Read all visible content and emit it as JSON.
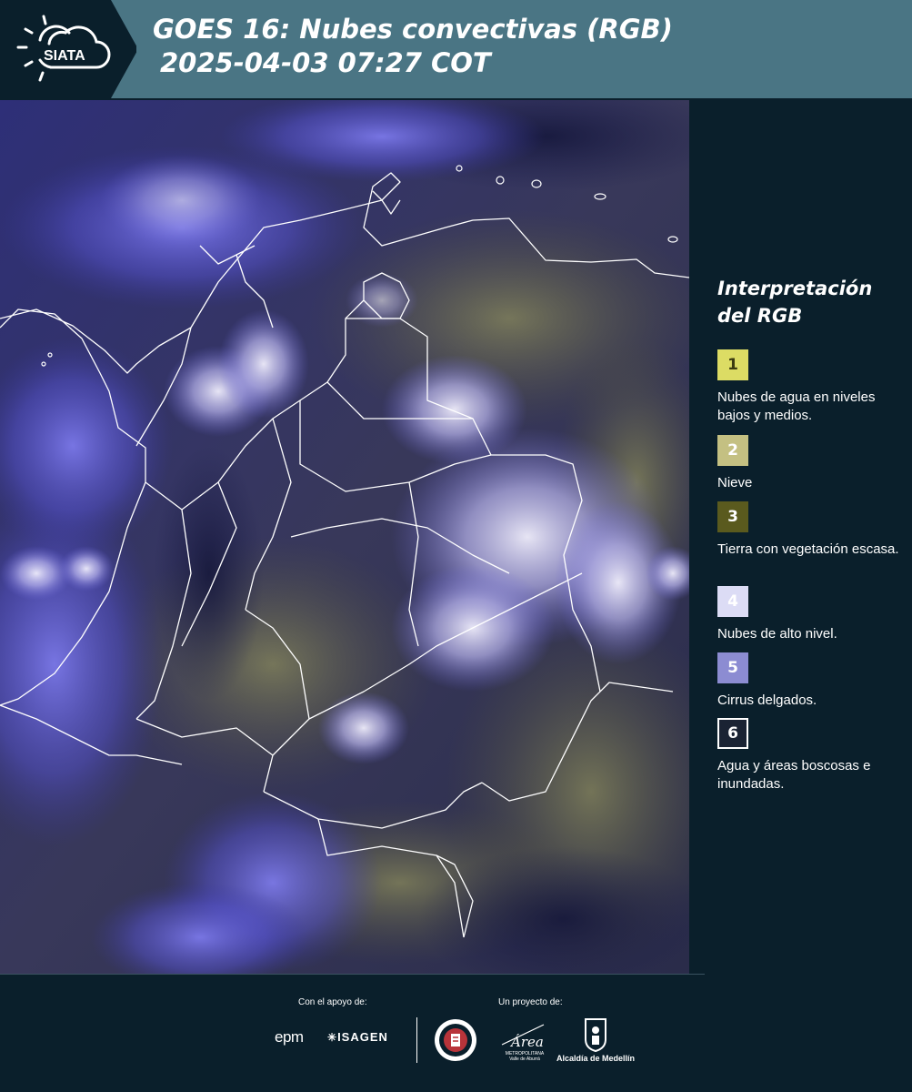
{
  "header": {
    "logo_text": "SIATA",
    "title_line1": "GOES 16: Nubes convectivas (RGB)",
    "title_line2": "2025-04-03 07:27 COT"
  },
  "legend": {
    "title": "Interpretación del RGB",
    "items": [
      {
        "number": "1",
        "label": "Nubes de agua en niveles bajos y medios.",
        "color": "#dcdc64",
        "text_color": "#3a3a10"
      },
      {
        "number": "2",
        "label": "Nieve",
        "color": "#c4c082",
        "text_color": "#ffffff"
      },
      {
        "number": "3",
        "label": "Tierra con vegetación escasa.",
        "color": "#5a5a1e",
        "text_color": "#ffffff"
      },
      {
        "number": "4",
        "label": "Nubes de alto nivel.",
        "color": "#dcdcf5",
        "text_color": "#ffffff"
      },
      {
        "number": "5",
        "label": "Cirrus delgados.",
        "color": "#8c8cd2",
        "text_color": "#ffffff"
      },
      {
        "number": "6",
        "label": "Agua y áreas boscosas e inundadas.",
        "color": "#1a2333",
        "text_color": "#ffffff"
      }
    ]
  },
  "footer": {
    "support_label": "Con el apoyo de:",
    "project_label": "Un proyecto de:",
    "epm_text": "epm",
    "isagen_text": "ISAGEN",
    "area_text": "Área",
    "area_subtext": "METROPOLITANA Valle de Aburrá",
    "alcaldia_text": "Alcaldía de Medellín"
  },
  "colors": {
    "background": "#0a1f2b",
    "header_bar": "#4a7584",
    "map_base": "#2b2c66"
  }
}
